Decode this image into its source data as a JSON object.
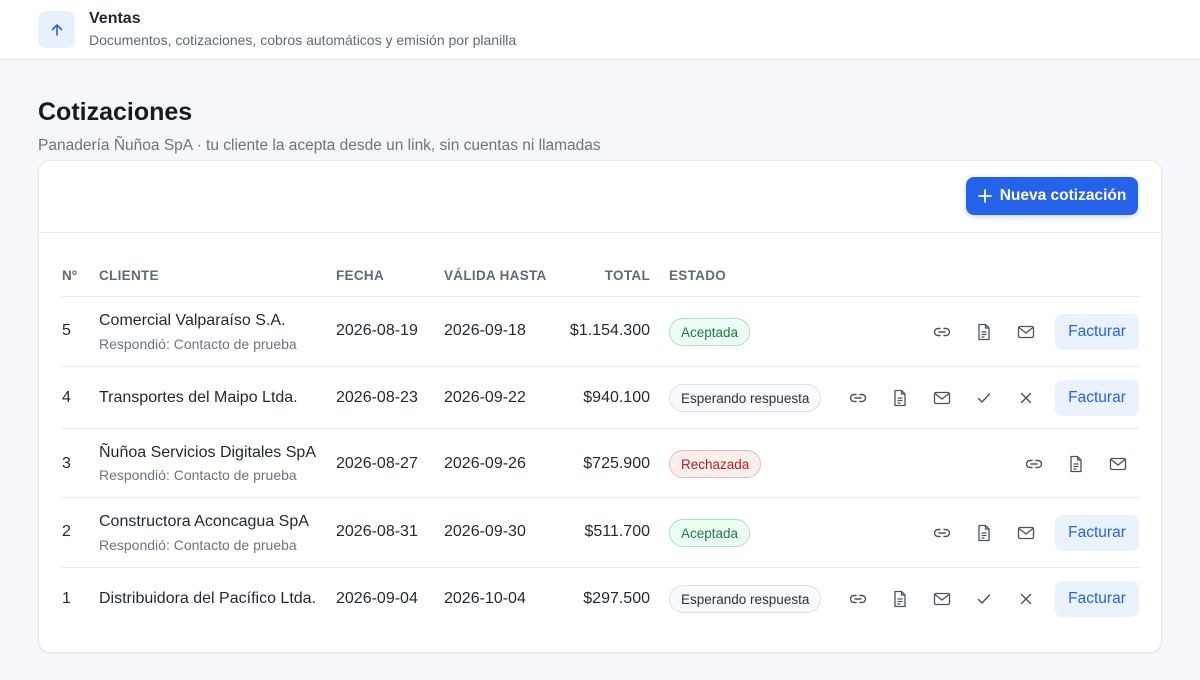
{
  "header": {
    "title": "Ventas",
    "subtitle": "Documentos, cotizaciones, cobros automáticos y emisión por planilla",
    "icon": "arrow-up-icon"
  },
  "page": {
    "title": "Cotizaciones",
    "subtitle": "Panadería Ñuñoa SpA · tu cliente la acepta desde un link, sin cuentas ni llamadas"
  },
  "toolbar": {
    "new_label": "Nueva cotización",
    "new_icon": "plus-icon"
  },
  "table": {
    "columns": [
      "Nº",
      "CLIENTE",
      "FECHA",
      "VÁLIDA HASTA",
      "TOTAL",
      "ESTADO"
    ],
    "rows": [
      {
        "num": "5",
        "client": "Comercial Valparaíso S.A.",
        "sub": "Respondió: Contacto de prueba",
        "fecha": "2026-08-19",
        "valida": "2026-09-18",
        "total": "$1.154.300",
        "estado": "Aceptada",
        "facturar": "Facturar"
      },
      {
        "num": "4",
        "client": "Transportes del Maipo Ltda.",
        "sub": "",
        "fecha": "2026-08-23",
        "valida": "2026-09-22",
        "total": "$940.100",
        "estado": "Esperando respuesta",
        "facturar": "Facturar"
      },
      {
        "num": "3",
        "client": "Ñuñoa Servicios Digitales SpA",
        "sub": "Respondió: Contacto de prueba",
        "fecha": "2026-08-27",
        "valida": "2026-09-26",
        "total": "$725.900",
        "estado": "Rechazada",
        "facturar": ""
      },
      {
        "num": "2",
        "client": "Constructora Aconcagua SpA",
        "sub": "Respondió: Contacto de prueba",
        "fecha": "2026-08-31",
        "valida": "2026-09-30",
        "total": "$511.700",
        "estado": "Aceptada",
        "facturar": "Facturar"
      },
      {
        "num": "1",
        "client": "Distribuidora del Pacífico Ltda.",
        "sub": "",
        "fecha": "2026-09-04",
        "valida": "2026-10-04",
        "total": "$297.500",
        "estado": "Esperando respuesta",
        "facturar": "Facturar"
      }
    ]
  },
  "colors": {
    "accent": "#2563eb",
    "accepted": "#1f7a44",
    "rejected": "#b42323"
  }
}
